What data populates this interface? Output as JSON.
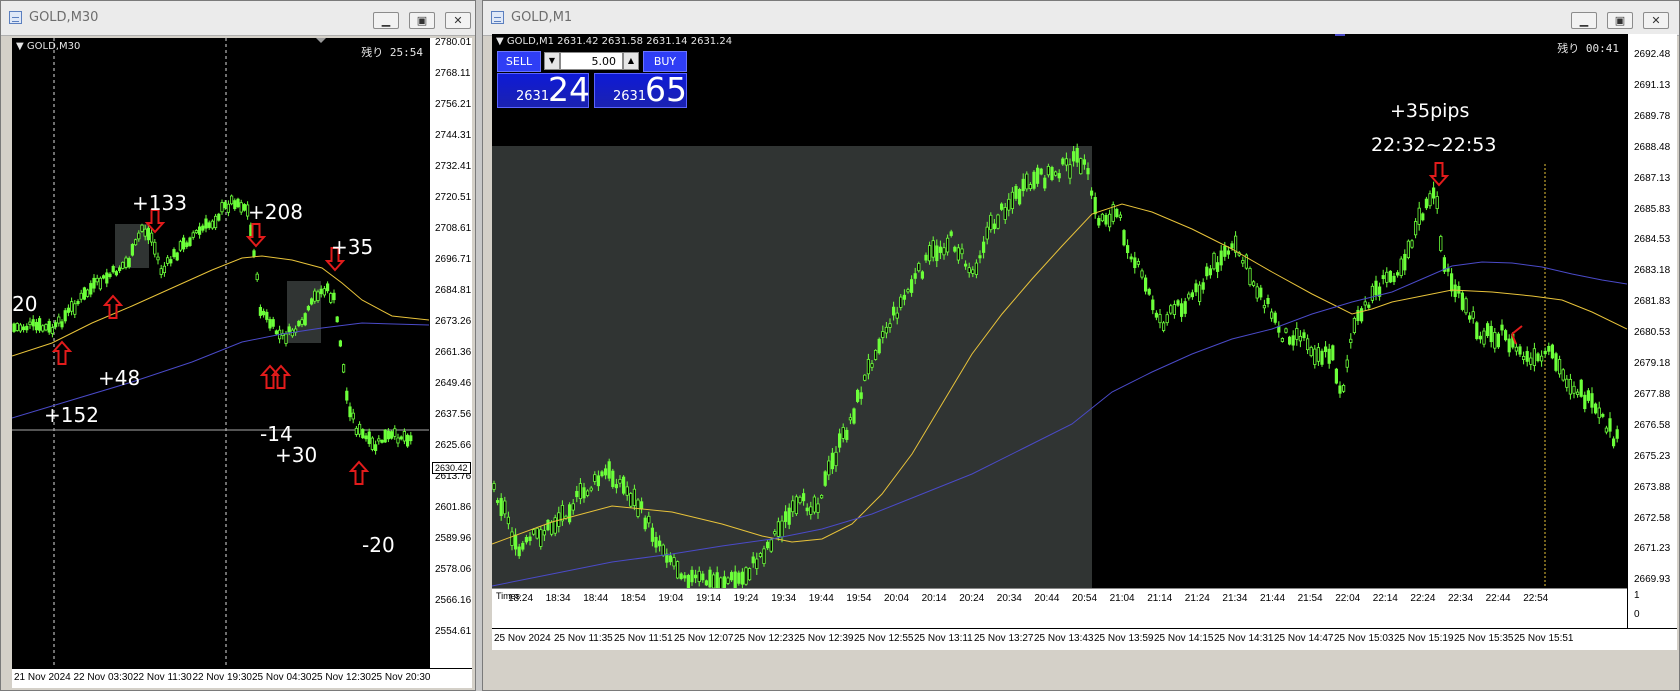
{
  "left_window": {
    "title": "GOLD,M30",
    "chart_label": "GOLD,M30",
    "remaining": "残り 25:54",
    "current_price": "2630.42",
    "price_labels": [
      "2780.01",
      "2768.11",
      "2756.21",
      "2744.31",
      "2732.41",
      "2720.51",
      "2708.61",
      "2696.71",
      "2684.81",
      "2673.26",
      "2661.36",
      "2649.46",
      "2637.56",
      "2625.66",
      "2613.76",
      "2601.86",
      "2589.96",
      "2578.06",
      "2566.16",
      "2554.61"
    ],
    "time_labels": [
      "21 Nov 2024",
      "22 Nov 03:30",
      "22 Nov 11:30",
      "22 Nov 19:30",
      "25 Nov 04:30",
      "25 Nov 12:30",
      "25 Nov 20:30"
    ],
    "annotations": [
      "20",
      "+133",
      "+208",
      "+35",
      "+48",
      "+152",
      "-14",
      "+30",
      "-20"
    ]
  },
  "right_window": {
    "title": "GOLD,M1",
    "chart_label": "GOLD,M1  2631.42 2631.58 2631.14 2631.24",
    "remaining": "残り 00:41",
    "trade_panel": {
      "sell_label": "SELL",
      "buy_label": "BUY",
      "lot": "5.00",
      "sell_big": "2631",
      "sell_pips": "24",
      "buy_big": "2631",
      "buy_pips": "65"
    },
    "annotation_pips": "+35pips",
    "annotation_time": "22:32~22:53",
    "price_labels": [
      "2692.48",
      "2691.13",
      "2689.78",
      "2688.48",
      "2687.13",
      "2685.83",
      "2684.53",
      "2683.18",
      "2681.83",
      "2680.53",
      "2679.18",
      "2677.88",
      "2676.58",
      "2675.23",
      "2673.88",
      "2672.58",
      "2671.23",
      "2669.93"
    ],
    "indicator_labels": [
      "0",
      "1"
    ],
    "indicator_name": "Times",
    "inner_time_labels": [
      "18:24",
      "18:34",
      "18:44",
      "18:54",
      "19:04",
      "19:14",
      "19:24",
      "19:34",
      "19:44",
      "19:54",
      "20:04",
      "20:14",
      "20:24",
      "20:34",
      "20:44",
      "20:54",
      "21:04",
      "21:14",
      "21:24",
      "21:34",
      "21:44",
      "21:54",
      "22:04",
      "22:14",
      "22:24",
      "22:34",
      "22:44",
      "22:54"
    ],
    "time_labels": [
      "25 Nov 2024",
      "25 Nov 11:35",
      "25 Nov 11:51",
      "25 Nov 12:07",
      "25 Nov 12:23",
      "25 Nov 12:39",
      "25 Nov 12:55",
      "25 Nov 13:11",
      "25 Nov 13:27",
      "25 Nov 13:43",
      "25 Nov 13:59",
      "25 Nov 14:15",
      "25 Nov 14:31",
      "25 Nov 14:47",
      "25 Nov 15:03",
      "25 Nov 15:19",
      "25 Nov 15:35",
      "25 Nov 15:51"
    ]
  },
  "colors": {
    "candle": "#6cff3a",
    "ma_fast": "#e8c33a",
    "ma_slow": "#4a4ac8",
    "arrow": "#e21b1b",
    "highlight": "#303433"
  },
  "icons": [
    "chart-window-icon",
    "minimize-icon",
    "maximize-icon",
    "close-icon",
    "dropdown-triangle-icon",
    "arrow-up-icon",
    "arrow-down-icon"
  ]
}
